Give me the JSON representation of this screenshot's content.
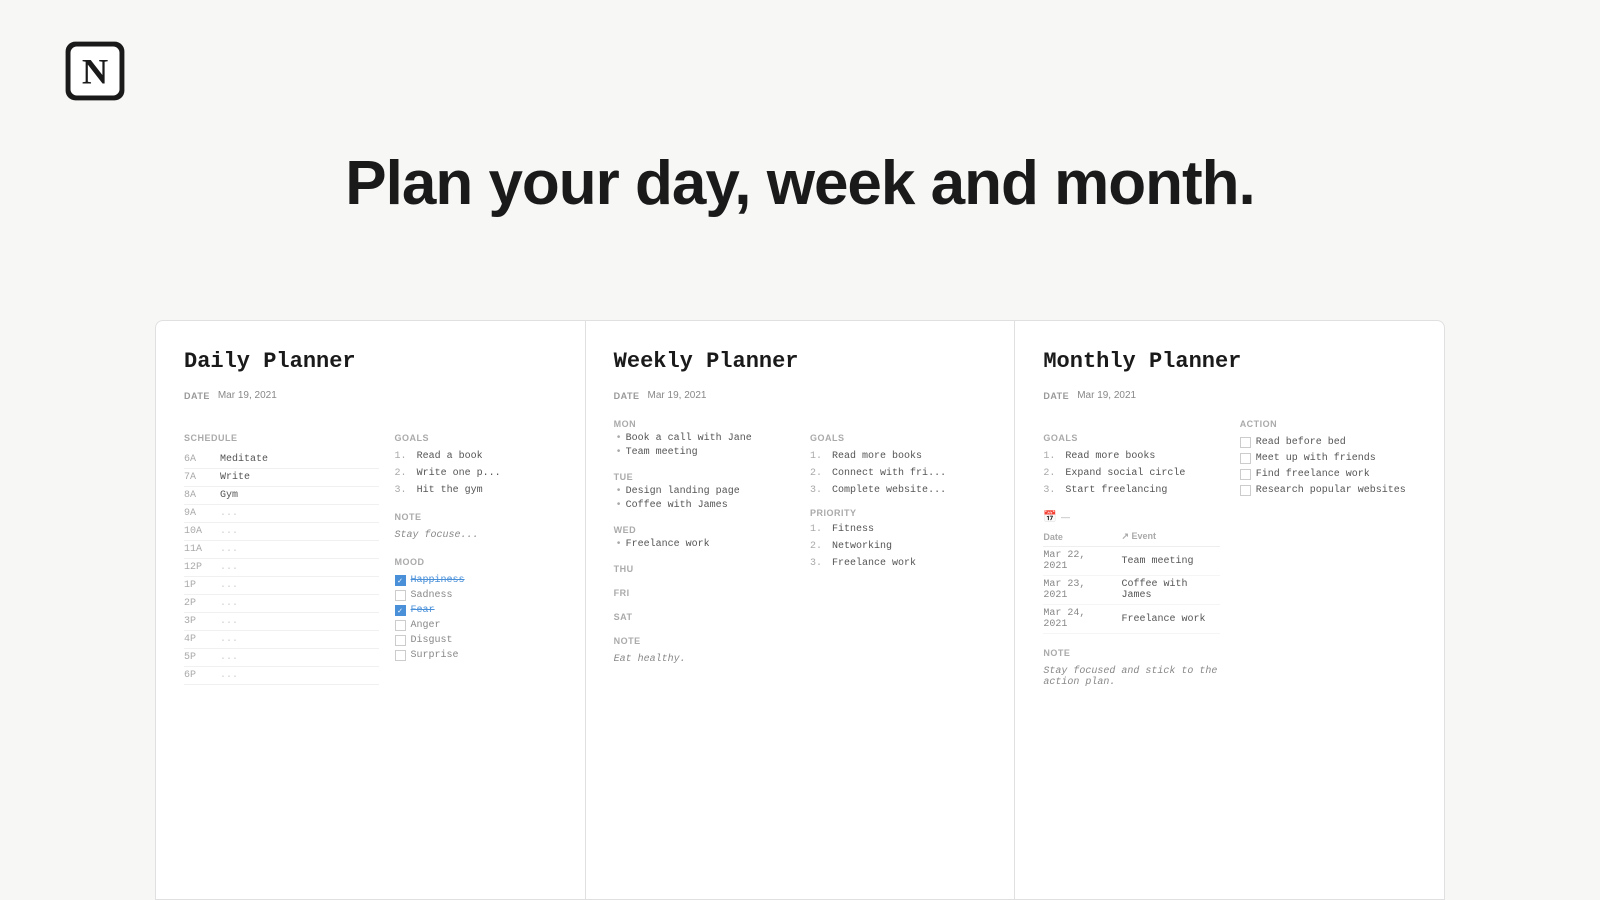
{
  "logo": {
    "alt": "Notion"
  },
  "hero": {
    "title": "Plan your day, week and month."
  },
  "daily_planner": {
    "title": "Daily Planner",
    "date_label": "DATE",
    "date_value": "Mar 19, 2021",
    "schedule_label": "SCHEDULE",
    "goals_label": "GOALS",
    "note_label": "NOTE",
    "mood_label": "MOOD",
    "schedule": [
      {
        "time": "6A",
        "value": "Meditate",
        "dots": false
      },
      {
        "time": "7A",
        "value": "Write",
        "dots": false
      },
      {
        "time": "8A",
        "value": "Gym",
        "dots": false
      },
      {
        "time": "9A",
        "value": "...",
        "dots": true
      },
      {
        "time": "10A",
        "value": "...",
        "dots": true
      },
      {
        "time": "11A",
        "value": "...",
        "dots": true
      },
      {
        "time": "12P",
        "value": "...",
        "dots": true
      },
      {
        "time": "1P",
        "value": "...",
        "dots": true
      },
      {
        "time": "2P",
        "value": "...",
        "dots": true
      },
      {
        "time": "3P",
        "value": "...",
        "dots": true
      },
      {
        "time": "4P",
        "value": "...",
        "dots": true
      },
      {
        "time": "5P",
        "value": "...",
        "dots": true
      },
      {
        "time": "6P",
        "value": "...",
        "dots": true
      }
    ],
    "goals": [
      {
        "num": "1.",
        "text": "Read a book"
      },
      {
        "num": "2.",
        "text": "Write one p..."
      },
      {
        "num": "3.",
        "text": "Hit the gym"
      }
    ],
    "note_text": "Stay focuse...",
    "moods": [
      {
        "label": "Happiness",
        "checked": true,
        "style": "blue"
      },
      {
        "label": "Sadness",
        "checked": false
      },
      {
        "label": "Fear",
        "checked": true,
        "style": "blue"
      },
      {
        "label": "Anger",
        "checked": false
      },
      {
        "label": "Disgust",
        "checked": false
      },
      {
        "label": "Surprise",
        "checked": false
      }
    ]
  },
  "weekly_planner": {
    "title": "Weekly Planner",
    "date_label": "DATE",
    "date_value": "Mar 19, 2021",
    "goals_label": "GOALS",
    "note_label": "NOTE",
    "priority_label": "PRIORITY",
    "note_text": "Eat healthy.",
    "days": [
      {
        "label": "MON",
        "items": [
          "Book a call with Jane",
          "Team meeting"
        ]
      },
      {
        "label": "TUE",
        "items": [
          "Design landing page",
          "Coffee with James"
        ]
      },
      {
        "label": "WED",
        "items": [
          "Freelance work"
        ]
      },
      {
        "label": "THU",
        "items": []
      },
      {
        "label": "FRI",
        "items": []
      },
      {
        "label": "SAT",
        "items": []
      }
    ],
    "goals": [
      {
        "num": "1.",
        "text": "Read more books"
      },
      {
        "num": "2.",
        "text": "Connect with fri..."
      },
      {
        "num": "3.",
        "text": "Complete website..."
      }
    ],
    "priorities": [
      {
        "num": "1.",
        "text": "Fitness"
      },
      {
        "num": "2.",
        "text": "Networking"
      },
      {
        "num": "3.",
        "text": "Freelance work"
      }
    ]
  },
  "monthly_planner": {
    "title": "Monthly Planner",
    "date_label": "DATE",
    "date_value": "Mar 19, 2021",
    "goals_label": "GOALS",
    "action_label": "ACTION",
    "note_label": "NOTE",
    "goals": [
      {
        "num": "1.",
        "text": "Read more books"
      },
      {
        "num": "2.",
        "text": "Expand social circle"
      },
      {
        "num": "3.",
        "text": "Start freelancing"
      }
    ],
    "actions": [
      {
        "label": "Read before bed",
        "checked": false
      },
      {
        "label": "Meet up with friends",
        "checked": false
      },
      {
        "label": "Find freelance work",
        "checked": false
      },
      {
        "label": "Research popular websites",
        "checked": false
      }
    ],
    "events_header": {
      "date_col": "Date",
      "event_col": "↗ Event"
    },
    "events": [
      {
        "date": "Mar 22, 2021",
        "event": "Team meeting"
      },
      {
        "date": "Mar 23, 2021",
        "event": "Coffee with James"
      },
      {
        "date": "Mar 24, 2021",
        "event": "Freelance work"
      }
    ],
    "note_text": "Stay focused and stick to the action plan."
  }
}
